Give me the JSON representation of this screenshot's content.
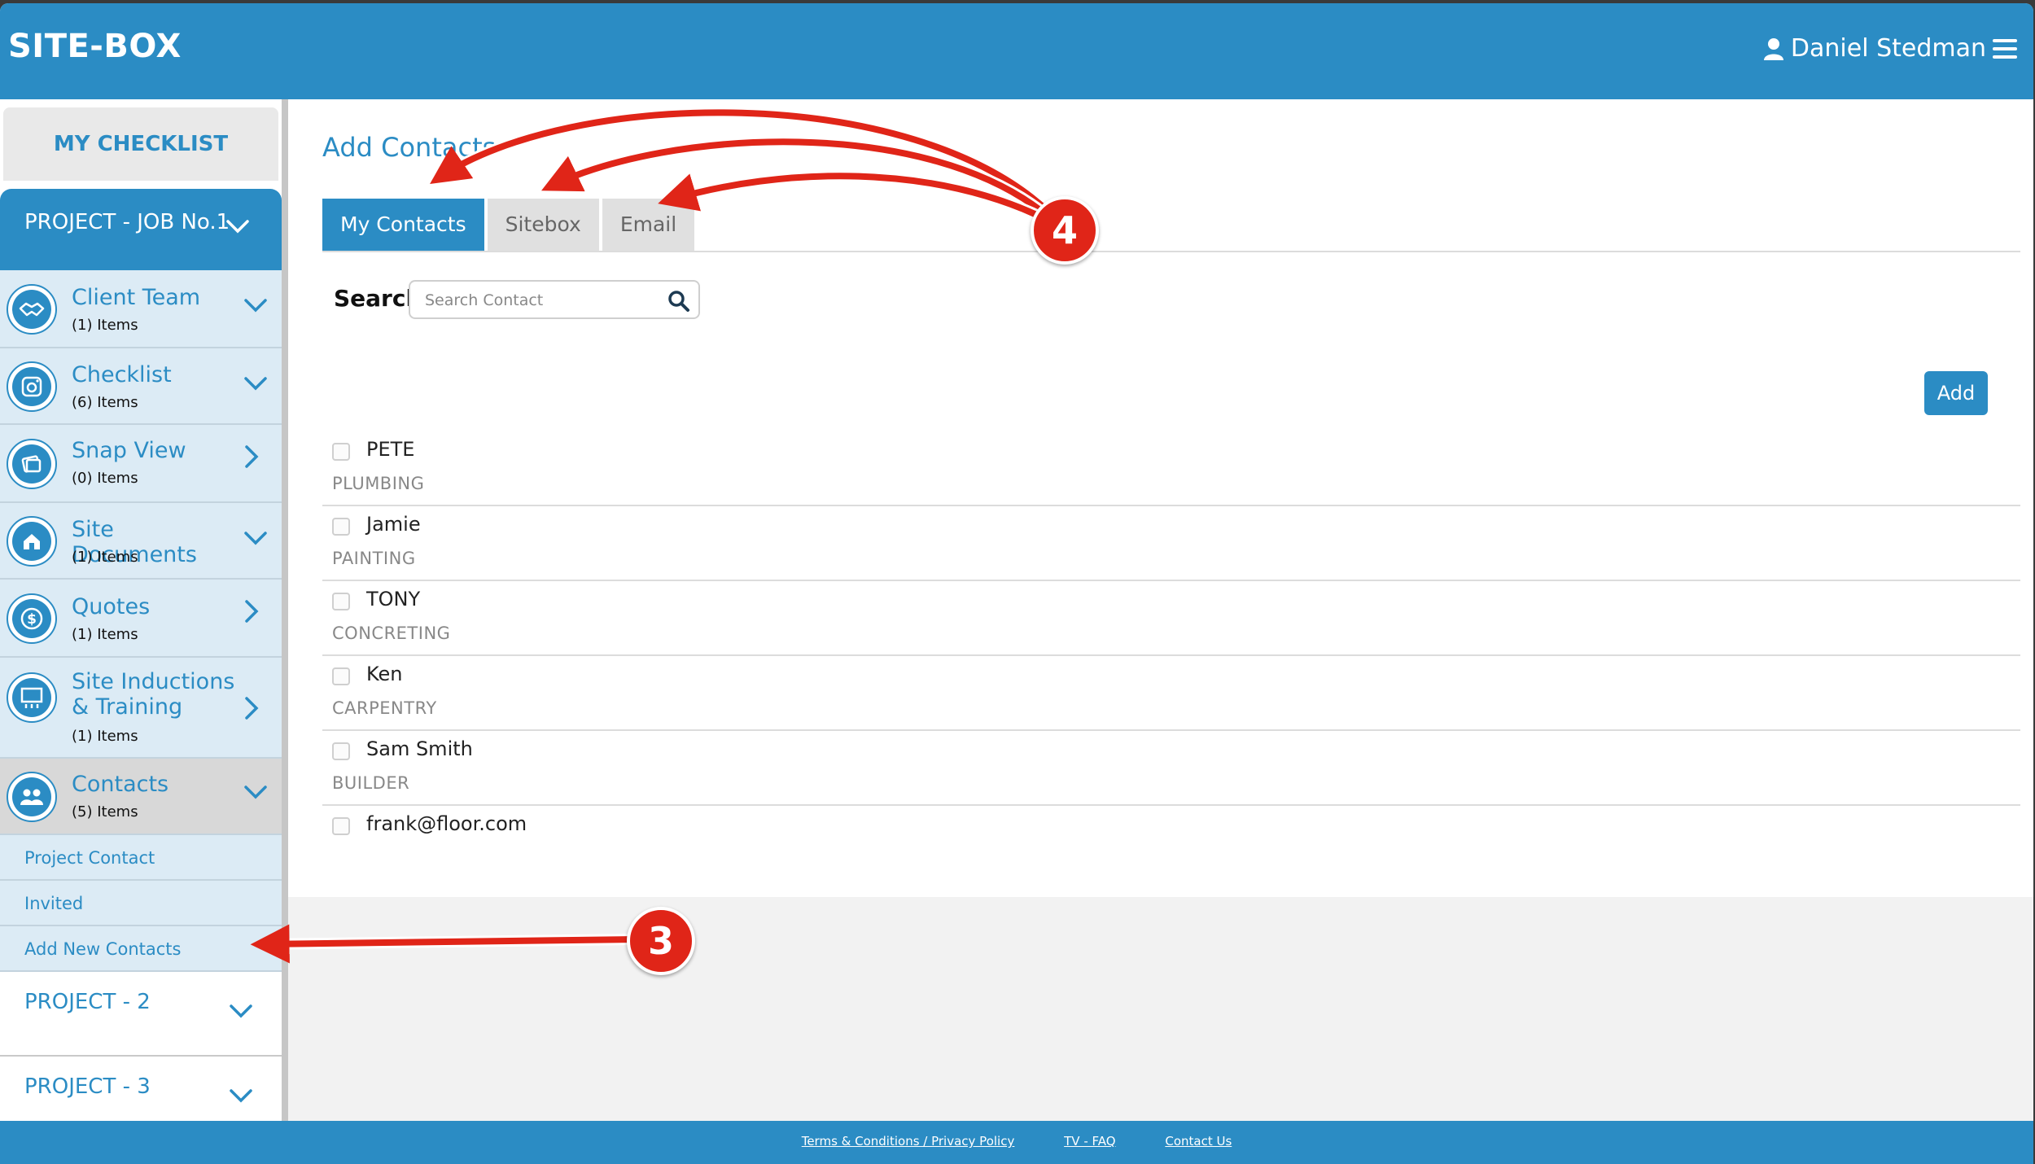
{
  "header": {
    "brand": "SITE-BOX",
    "user_name": "Daniel Stedman"
  },
  "sidebar": {
    "checklist_button": "MY CHECKLIST",
    "project_active": "PROJECT - JOB No.1",
    "items": [
      {
        "title": "Client Team",
        "count": "(1) Items",
        "icon": "handshake-icon",
        "chevron": "down"
      },
      {
        "title": "Checklist",
        "count": "(6) Items",
        "icon": "camera-icon",
        "chevron": "down"
      },
      {
        "title": "Snap View",
        "count": "(0) Items",
        "icon": "photos-icon",
        "chevron": "right"
      },
      {
        "title": "Site Documents",
        "count": "(1) Items",
        "icon": "documents-icon",
        "chevron": "down"
      },
      {
        "title": "Quotes",
        "count": "(1) Items",
        "icon": "dollar-icon",
        "chevron": "right"
      },
      {
        "title": "Site Inductions & Training",
        "count": "(1) Items",
        "icon": "training-icon",
        "chevron": "right"
      },
      {
        "title": "Contacts",
        "count": "(5) Items",
        "icon": "people-icon",
        "chevron": "down"
      }
    ],
    "contact_subitems": [
      "Project Contact",
      "Invited",
      "Add New Contacts"
    ],
    "other_projects": [
      "PROJECT - 2",
      "PROJECT - 3"
    ]
  },
  "main": {
    "title": "Add Contacts",
    "tabs": [
      "My Contacts",
      "Sitebox",
      "Email"
    ],
    "active_tab": "My Contacts",
    "search_label": "Search",
    "search_placeholder": "Search Contact",
    "add_button": "Add",
    "contacts": [
      {
        "name": "PETE",
        "trade": "PLUMBING"
      },
      {
        "name": "Jamie",
        "trade": "PAINTING"
      },
      {
        "name": "TONY",
        "trade": "CONCRETING"
      },
      {
        "name": "Ken",
        "trade": "CARPENTRY"
      },
      {
        "name": "Sam Smith",
        "trade": "BUILDER"
      },
      {
        "name": "frank@floor.com",
        "trade": ""
      }
    ]
  },
  "footer": {
    "links": [
      "Terms & Conditions / Privacy Policy",
      "TV - FAQ",
      "Contact Us"
    ]
  },
  "annotations": {
    "badge_tabs": "4",
    "badge_add_new": "3"
  },
  "colors": {
    "primary": "#2b8cc4",
    "sidebar_item_bg": "#dcebf5",
    "annotation_red": "#e02518"
  }
}
